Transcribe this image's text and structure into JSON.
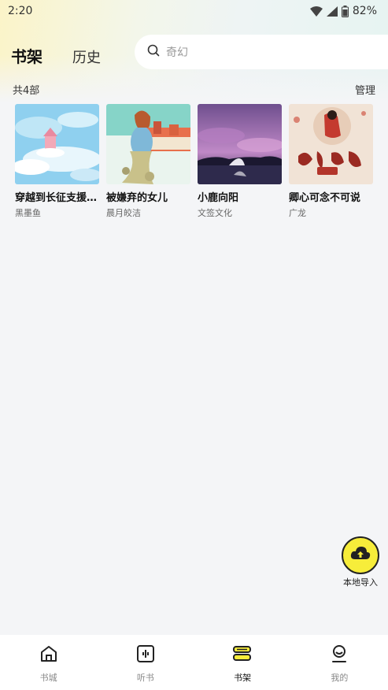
{
  "status_bar": {
    "time": "2:20",
    "battery": "82%"
  },
  "header": {
    "tabs": [
      {
        "label": "书架",
        "active": true
      },
      {
        "label": "历史",
        "active": false
      }
    ],
    "search": {
      "placeholder": "奇幻"
    }
  },
  "shelf": {
    "count_label": "共4部",
    "manage_label": "管理",
    "books": [
      {
        "title": "穿越到长征支援红军",
        "author": "黑墨鱼",
        "cover_icon": "sky-castle-cover"
      },
      {
        "title": "被嫌弃的女儿",
        "author": "晨月皎洁",
        "cover_icon": "girl-town-cover"
      },
      {
        "title": "小鹿向阳",
        "author": "文签文化",
        "cover_icon": "night-deer-cover"
      },
      {
        "title": "卿心可念不可说",
        "author": "广龙",
        "cover_icon": "calligraphy-cover"
      }
    ]
  },
  "import_button": {
    "label": "本地导入"
  },
  "bottom_nav": [
    {
      "label": "书城",
      "icon": "home-icon",
      "active": false
    },
    {
      "label": "听书",
      "icon": "audio-icon",
      "active": false
    },
    {
      "label": "书架",
      "icon": "bookshelf-icon",
      "active": true
    },
    {
      "label": "我的",
      "icon": "profile-icon",
      "active": false
    }
  ],
  "colors": {
    "accent": "#f7ed3a",
    "background": "#f4f5f7"
  }
}
